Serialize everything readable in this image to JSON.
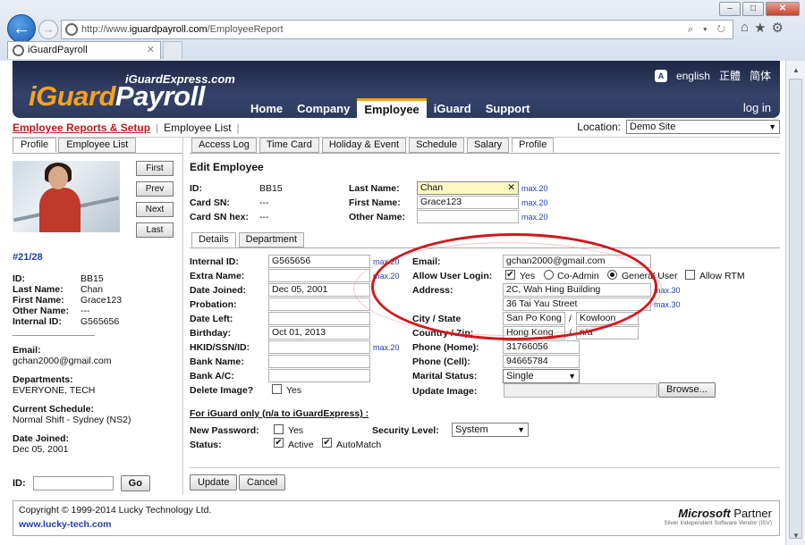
{
  "browser": {
    "address_prefix": "http://www.",
    "address_domain": "iguardpayroll.com",
    "address_path": "/EmployeeReport",
    "address_tools": "⌕ ▾ ↻",
    "tab_title": "iGuardPayroll",
    "win_min": "–",
    "win_max": "□",
    "win_close": "✕",
    "back_glyph": "←",
    "forward_glyph": "→",
    "home_glyph": "⌂",
    "fav_glyph": "★",
    "gear_glyph": "⚙",
    "tab_close": "✕"
  },
  "header": {
    "logo_small": "iGuardExpress.com",
    "logo_i": "i",
    "logo_guard": "Guard",
    "logo_payroll": "Payroll",
    "lang_icon": "A",
    "lang_en": "english",
    "lang_tc": "正體",
    "lang_sc": "简体",
    "nav": [
      "Home",
      "Company",
      "Employee",
      "iGuard",
      "Support"
    ],
    "login": "log in"
  },
  "subbar": {
    "crumb1": "Employee Reports & Setup",
    "sep": "|",
    "crumb2": "Employee List",
    "sep2": "|",
    "location_label": "Location:",
    "location_value": "Demo Site",
    "dropdown_arrow": "▼"
  },
  "left": {
    "tabs": [
      "Profile",
      "Employee List"
    ],
    "buttons": [
      "First",
      "Prev",
      "Next",
      "Last"
    ],
    "record": "#21/28",
    "fields": [
      {
        "k": "ID:",
        "v": "BB15"
      },
      {
        "k": "Last Name:",
        "v": "Chan"
      },
      {
        "k": "First Name:",
        "v": "Grace123"
      },
      {
        "k": "Other Name:",
        "v": "---"
      },
      {
        "k": "Internal ID:",
        "v": "G565656"
      }
    ],
    "email_label": "Email:",
    "email": "gchan2000@gmail.com",
    "dept_label": "Departments:",
    "dept": "EVERYONE, TECH",
    "sched_label": "Current Schedule:",
    "sched": "Normal Shift - Sydney (NS2)",
    "joined_label": "Date Joined:",
    "joined": "Dec 05, 2001",
    "id_label": "ID:",
    "go": "Go"
  },
  "right": {
    "tabs": [
      "Access Log",
      "Time Card",
      "Holiday & Event",
      "Schedule",
      "Salary",
      "Profile"
    ],
    "title": "Edit Employee",
    "id_label": "ID:",
    "id_value": "BB15",
    "cardsn_label": "Card SN:",
    "cardsn_value": "---",
    "cardhex_label": "Card SN hex:",
    "cardhex_value": "---",
    "lastname_label": "Last Name:",
    "lastname_value": "Chan",
    "firstname_label": "First Name:",
    "firstname_value": "Grace123",
    "othername_label": "Other Name:",
    "othername_value": "",
    "clear_glyph": "✕",
    "max20": "max.20",
    "max30": "max.30",
    "detail_tabs": [
      "Details",
      "Department"
    ],
    "internal_label": "Internal ID:",
    "internal_value": "G565656",
    "extra_label": "Extra Name:",
    "joined_label": "Date Joined:",
    "joined_value": "Dec 05, 2001",
    "probation_label": "Probation:",
    "left_label": "Date Left:",
    "birthday_label": "Birthday:",
    "birthday_value": "Oct 01, 2013",
    "hkid_label": "HKID/SSN/ID:",
    "bank_label": "Bank Name:",
    "bankac_label": "Bank A/C:",
    "delimg_label": "Delete Image?",
    "yes": "Yes",
    "email_label": "Email:",
    "email_value": "gchan2000@gmail.com",
    "allow_label": "Allow User Login:",
    "allow_yes": "Yes",
    "coadmin": "Co-Admin",
    "general": "General User",
    "allow_rtm": "Allow RTM",
    "address_label": "Address:",
    "addr1": "2C, Wah Hing Building",
    "addr2": "36 Tai Yau Street",
    "city_label": "City / State",
    "city": "San Po Kong",
    "state": "Kowloon",
    "slash": "/",
    "country_label": "Country / Zip:",
    "country": "Hong Kong",
    "zip": "n/a",
    "phone_home_label": "Phone (Home):",
    "phone_home": "31766056",
    "phone_cell_label": "Phone (Cell):",
    "phone_cell": "94665784",
    "marital_label": "Marital Status:",
    "marital": "Single",
    "update_img_label": "Update Image:",
    "browse": "Browse...",
    "iguard_only": "For iGuard only (n/a to iGuardExpress) :",
    "newpw_label": "New Password:",
    "newpw_yes": "Yes",
    "seclevel_label": "Security Level:",
    "seclevel": "System",
    "status_label": "Status:",
    "active": "Active",
    "automatch": "AutoMatch",
    "check_glyph": "✔",
    "update": "Update",
    "cancel": "Cancel"
  },
  "footer": {
    "copyright": "Copyright © 1999-2014 Lucky Technology Ltd.",
    "site": "www.lucky-tech.com",
    "ms_name": "Microsoft",
    "ms_partner": " Partner",
    "ms_sub": "Silver Independent Software Vendor (ISV)"
  },
  "scroll": {
    "up": "▲",
    "down": "▼"
  }
}
